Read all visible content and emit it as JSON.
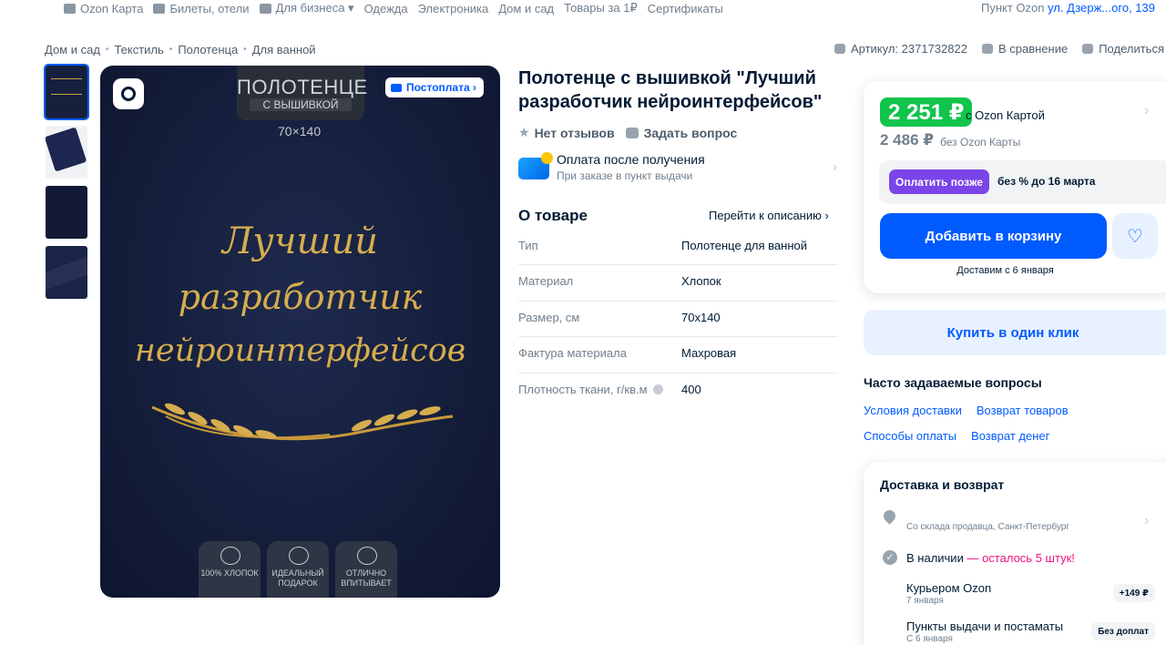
{
  "topnav": {
    "links": [
      "Ozon Карта",
      "Билеты, отели",
      "Для бизнеса ▾",
      "Одежда",
      "Электроника",
      "Дом и сад",
      "Товары за 1₽",
      "Сертификаты"
    ],
    "pickup_label": "Пункт Ozon",
    "pickup_address": "ул. Дзерж...ого, 139"
  },
  "breadcrumbs": [
    "Дом и сад",
    "Текстиль",
    "Полотенца",
    "Для ванной"
  ],
  "meta": {
    "article": "Артикул: 2371732822",
    "compare": "В сравнение",
    "share": "Поделиться"
  },
  "hero": {
    "tag_line1": "ПОЛОТЕНЦЕ",
    "tag_line2": "С ВЫШИВКОЙ",
    "size": "70×140",
    "postpay": "Постоплата",
    "script_line1": "Лучший",
    "script_line2": "разработчик",
    "script_line3": "нейроинтерфейсов",
    "badges": [
      "100% хлопок",
      "идеальный подарок",
      "отлично впитывает"
    ]
  },
  "product": {
    "title": "Полотенце с вышивкой \"Лучший разработчик нейроинтерфейсов\"",
    "reviews": "Нет отзывов",
    "ask": "Задать вопрос",
    "pay_after": "Оплата после получения",
    "pay_after_sub": "При заказе в пункт выдачи",
    "about_title": "О товаре",
    "about_link": "Перейти к описанию ›",
    "specs": [
      {
        "k": "Тип",
        "v": "Полотенце для ванной"
      },
      {
        "k": "Материал",
        "v": "Хлопок"
      },
      {
        "k": "Размер, см",
        "v": "70x140"
      },
      {
        "k": "Фактура материала",
        "v": "Махровая"
      },
      {
        "k": "Плотность ткани, г/кв.м",
        "v": "400"
      }
    ]
  },
  "price": {
    "ozon_price": "2 251 ₽",
    "ozon_label": "с Ozon Картой",
    "regular_price": "2 486 ₽",
    "regular_label": "без Ozon Карты",
    "pay_later_btn": "Оплатить позже",
    "pay_later_text": "без % до 16 марта",
    "add_to_cart": "Добавить в корзину",
    "delivery_from": "Доставим с 6 января",
    "one_click": "Купить в один клик"
  },
  "faq": {
    "title": "Часто задаваемые вопросы",
    "links": [
      "Условия доставки",
      "Возврат товаров",
      "Способы оплаты",
      "Возврат денег"
    ]
  },
  "delivery": {
    "title": "Доставка и возврат",
    "from": "Со склада продавца, Санкт-Петербург",
    "in_stock": "В наличии",
    "left": "— осталось 5 штук!",
    "courier": "Курьером Ozon",
    "courier_date": "7 января",
    "courier_price": "+149 ₽",
    "pickup": "Пункты выдачи и постаматы",
    "pickup_date": "С 6 января",
    "pickup_price": "Без доплат"
  },
  "colors": {
    "brand_blue": "#005bff",
    "ozon_green": "#10c44c",
    "pay_later_purple": "#7b44e8",
    "stock_pink": "#f1117e"
  }
}
